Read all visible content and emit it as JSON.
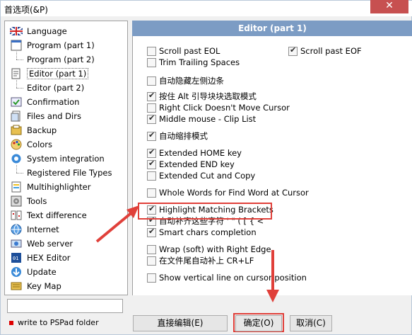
{
  "window": {
    "title": "首选项(&P)",
    "close_label": "✕"
  },
  "sidebar": {
    "items": [
      {
        "label": "Language",
        "icon": "uk-flag-icon"
      },
      {
        "label": "Program  (part 1)",
        "icon": "program-icon"
      },
      {
        "label": "Program  (part 2)",
        "icon": "",
        "sub": true
      },
      {
        "label": "Editor  (part 1)",
        "icon": "editor-icon",
        "selected": true
      },
      {
        "label": "Editor  (part 2)",
        "icon": "",
        "sub": true
      },
      {
        "label": "Confirmation",
        "icon": "confirmation-icon"
      },
      {
        "label": "Files and Dirs",
        "icon": "files-icon"
      },
      {
        "label": "Backup",
        "icon": "backup-icon"
      },
      {
        "label": "Colors",
        "icon": "colors-icon"
      },
      {
        "label": "System integration",
        "icon": "system-icon"
      },
      {
        "label": "Registered File Types",
        "icon": "",
        "sub": true
      },
      {
        "label": "Multihighlighter",
        "icon": "multihighlighter-icon"
      },
      {
        "label": "Tools",
        "icon": "tools-icon"
      },
      {
        "label": "Text difference",
        "icon": "text-diff-icon"
      },
      {
        "label": "Internet",
        "icon": "internet-icon"
      },
      {
        "label": "Web server",
        "icon": "web-server-icon"
      },
      {
        "label": "HEX Editor",
        "icon": "hex-icon"
      },
      {
        "label": "Update",
        "icon": "update-icon"
      },
      {
        "label": "Key Map",
        "icon": "keymap-icon"
      }
    ],
    "search_value": "",
    "status_message": "write to PSPad folder"
  },
  "panel": {
    "title": "Editor  (part 1)",
    "options": [
      {
        "label": "Scroll past EOL",
        "checked": false
      },
      {
        "label": "Scroll past EOF",
        "checked": true
      },
      {
        "label": "Trim Trailing Spaces",
        "checked": false
      },
      {
        "label": "自动隐藏左侧边条",
        "checked": false
      },
      {
        "label": "按住 Alt 引导块块选取模式",
        "checked": true
      },
      {
        "label": "Right Click Doesn't Move Cursor",
        "checked": false
      },
      {
        "label": "Middle mouse - Clip List",
        "checked": true
      },
      {
        "label": "自动缩排模式",
        "checked": true
      },
      {
        "label": "Extended HOME key",
        "checked": true
      },
      {
        "label": "Extended END key",
        "checked": true
      },
      {
        "label": "Extended Cut and Copy",
        "checked": false
      },
      {
        "label": "Whole Words for Find Word at Cursor",
        "checked": false
      },
      {
        "label": "Highlight Matching Brackets",
        "checked": true
      },
      {
        "label": "自动补齐这些字符 ' \" ( [ { <",
        "checked": true
      },
      {
        "label": "Smart chars completion",
        "checked": true
      },
      {
        "label": "Wrap (soft) with Right Edge",
        "checked": false
      },
      {
        "label": "在文件尾自动补上 CR+LF",
        "checked": false
      },
      {
        "label": "Show vertical line on cursor position",
        "checked": false
      }
    ]
  },
  "buttons": {
    "edit_label": "直接编辑(E)",
    "ok_label": "确定(O)",
    "cancel_label": "取消(C)"
  },
  "colors": {
    "panel_header": "#7c9cc4",
    "annotation_red": "#e0403a"
  }
}
